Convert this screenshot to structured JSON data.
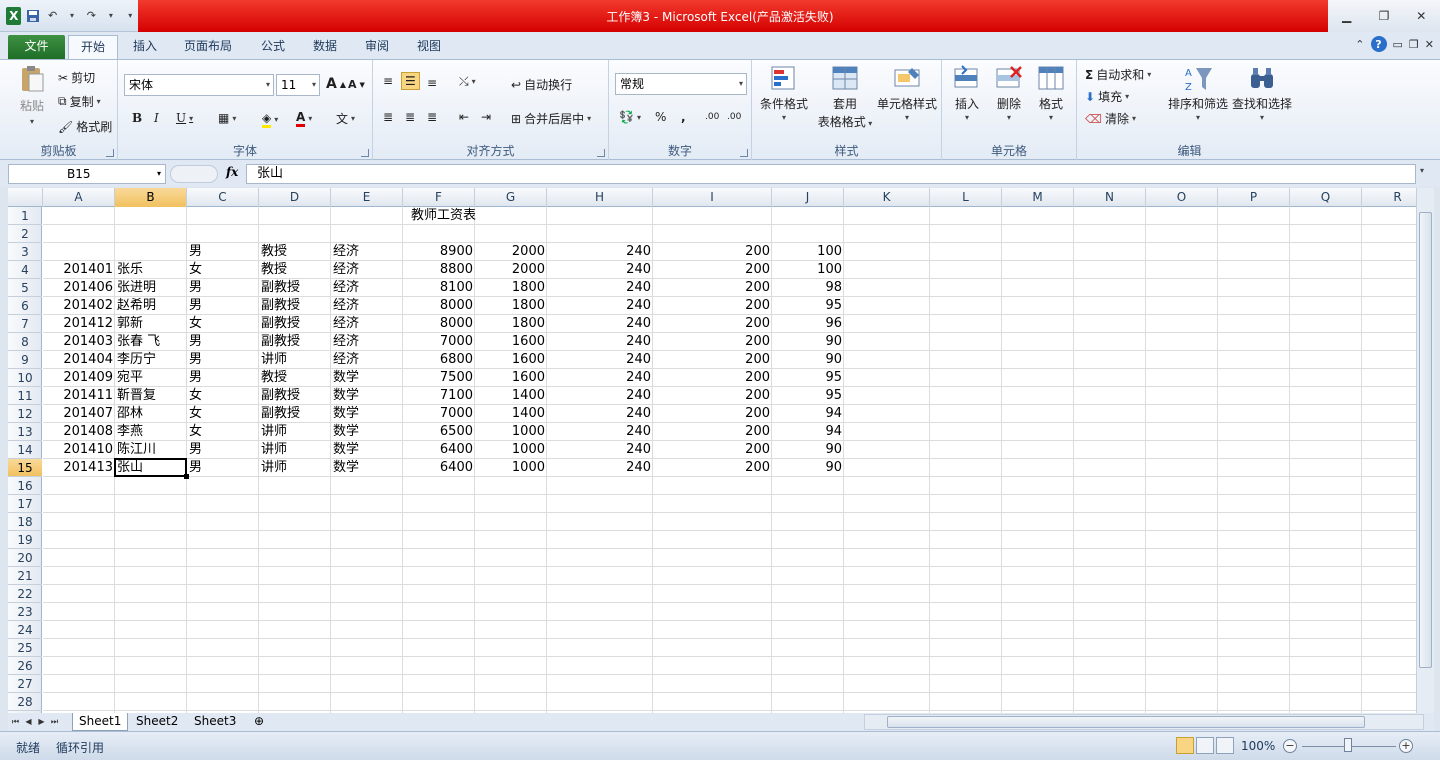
{
  "window": {
    "title": "工作簿3 - Microsoft Excel(产品激活失败)",
    "qat_items": [
      "excel-logo",
      "save-icon",
      "undo-icon",
      "redo-icon",
      "customize-qat-icon"
    ],
    "controls": [
      "minimize-icon",
      "restore-icon",
      "close-icon"
    ]
  },
  "tabs": [
    {
      "label": "文件",
      "active": false
    },
    {
      "label": "开始",
      "active": true
    },
    {
      "label": "插入",
      "active": false
    },
    {
      "label": "页面布局",
      "active": false
    },
    {
      "label": "公式",
      "active": false
    },
    {
      "label": "数据",
      "active": false
    },
    {
      "label": "审阅",
      "active": false
    },
    {
      "label": "视图",
      "active": false
    }
  ],
  "ribbon": {
    "clipboard": {
      "title": "剪贴板",
      "paste": "粘贴",
      "cut": "剪切",
      "copy": "复制",
      "format_painter": "格式刷"
    },
    "font": {
      "title": "字体",
      "font_name": "宋体",
      "font_size": "11",
      "bold": "B",
      "italic": "I",
      "underline": "U",
      "grow": "A",
      "shrink": "A",
      "font_color_glyph": "A",
      "phonetic_glyph": "文"
    },
    "alignment": {
      "title": "对齐方式",
      "wrap_text": "自动换行",
      "merge_center": "合并后居中"
    },
    "number": {
      "title": "数字",
      "format": "常规",
      "percent": "%",
      "comma": ",",
      "inc_decimal": ".00",
      "dec_decimal": ".00"
    },
    "styles": {
      "title": "样式",
      "conditional": "条件格式",
      "format_table_1": "套用",
      "format_table_2": "表格格式",
      "cell_styles": "单元格样式"
    },
    "cells": {
      "title": "单元格",
      "insert": "插入",
      "delete": "删除",
      "format": "格式"
    },
    "editing": {
      "title": "编辑",
      "autosum": "自动求和",
      "fill": "填充",
      "clear": "清除",
      "sort_filter": "排序和筛选",
      "find_select": "查找和选择"
    }
  },
  "formula_bar": {
    "name_box": "B15",
    "fx": "fx",
    "content": "张山"
  },
  "grid": {
    "columns": [
      "A",
      "B",
      "C",
      "D",
      "E",
      "F",
      "G",
      "H",
      "I",
      "J",
      "K",
      "L",
      "M",
      "N",
      "O",
      "P",
      "Q",
      "R"
    ],
    "selected_column": "B",
    "rows": [
      "1",
      "2",
      "3",
      "4",
      "5",
      "6",
      "7",
      "8",
      "9",
      "10",
      "11",
      "12",
      "13",
      "14",
      "15",
      "16",
      "17",
      "18",
      "19",
      "20",
      "21",
      "22",
      "23",
      "24",
      "25",
      "26",
      "27",
      "28"
    ],
    "selected_row": "15",
    "title_cell": "教师工资表",
    "data_rows": [
      [
        "",
        "",
        "男",
        "教授",
        "经济",
        "8900",
        "2000",
        "240",
        "200",
        "100"
      ],
      [
        "201401",
        "张乐",
        "女",
        "教授",
        "经济",
        "8800",
        "2000",
        "240",
        "200",
        "100"
      ],
      [
        "201406",
        "张进明",
        "男",
        "副教授",
        "经济",
        "8100",
        "1800",
        "240",
        "200",
        "98"
      ],
      [
        "201402",
        "赵希明",
        "男",
        "副教授",
        "经济",
        "8000",
        "1800",
        "240",
        "200",
        "95"
      ],
      [
        "201412",
        "郭新",
        "女",
        "副教授",
        "经济",
        "8000",
        "1800",
        "240",
        "200",
        "96"
      ],
      [
        "201403",
        "张春 飞",
        "男",
        "副教授",
        "经济",
        "7000",
        "1600",
        "240",
        "200",
        "90"
      ],
      [
        "201404",
        "李历宁",
        "男",
        "讲师",
        "经济",
        "6800",
        "1600",
        "240",
        "200",
        "90"
      ],
      [
        "201409",
        "宛平",
        "男",
        "教授",
        "数学",
        "7500",
        "1600",
        "240",
        "200",
        "95"
      ],
      [
        "201411",
        "靳晋复",
        "女",
        "副教授",
        "数学",
        "7100",
        "1400",
        "240",
        "200",
        "95"
      ],
      [
        "201407",
        "邵林",
        "女",
        "副教授",
        "数学",
        "7000",
        "1400",
        "240",
        "200",
        "94"
      ],
      [
        "201408",
        "李燕",
        "女",
        "讲师",
        "数学",
        "6500",
        "1000",
        "240",
        "200",
        "94"
      ],
      [
        "201410",
        "陈江川",
        "男",
        "讲师",
        "数学",
        "6400",
        "1000",
        "240",
        "200",
        "90"
      ],
      [
        "201413",
        "张山",
        "男",
        "讲师",
        "数学",
        "6400",
        "1000",
        "240",
        "200",
        "90"
      ]
    ]
  },
  "sheets": [
    {
      "label": "Sheet1",
      "active": true
    },
    {
      "label": "Sheet2",
      "active": false
    },
    {
      "label": "Sheet3",
      "active": false
    }
  ],
  "status": {
    "mode": "就绪",
    "circular": "循环引用",
    "zoom": "100%",
    "zoom_minus": "−",
    "zoom_plus": "+"
  },
  "colors": {
    "title_bar": "#e00000",
    "file_tab": "#2a7f34",
    "selection_header": "#f5cd78",
    "grid_line": "#dadcdd"
  }
}
